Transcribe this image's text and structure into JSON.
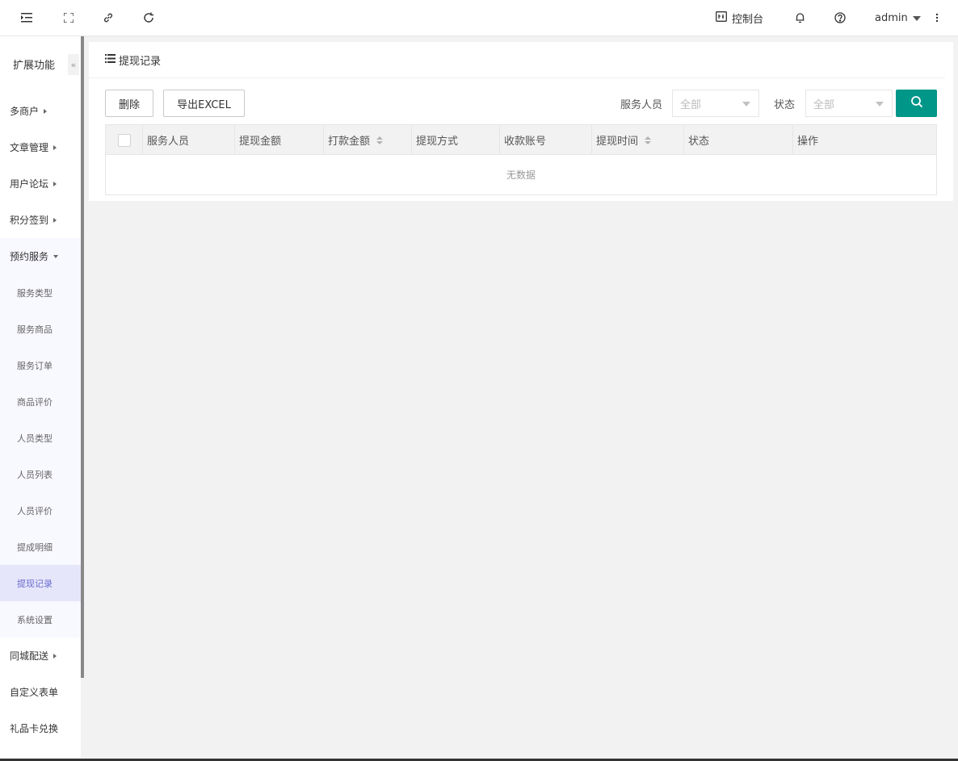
{
  "header": {
    "console_label": "控制台",
    "user_name": "admin",
    "icons": [
      "menu-fold-icon",
      "fullscreen-icon",
      "link-icon",
      "refresh-icon",
      "console-icon",
      "bell-icon",
      "help-icon",
      "more-vertical-icon"
    ]
  },
  "sidebar": {
    "title": "扩展功能",
    "collapse_label": "«",
    "items": [
      {
        "label": "多商户"
      },
      {
        "label": "文章管理"
      },
      {
        "label": "用户论坛"
      },
      {
        "label": "积分签到"
      },
      {
        "label": "预约服务"
      },
      {
        "label": "同城配送"
      },
      {
        "label": "自定义表单"
      },
      {
        "label": "礼品卡兑换"
      }
    ],
    "sub_items": [
      {
        "label": "服务类型"
      },
      {
        "label": "服务商品"
      },
      {
        "label": "服务订单"
      },
      {
        "label": "商品评价"
      },
      {
        "label": "人员类型"
      },
      {
        "label": "人员列表"
      },
      {
        "label": "人员评价"
      },
      {
        "label": "提成明细"
      },
      {
        "label": "提现记录"
      },
      {
        "label": "系统设置"
      }
    ]
  },
  "main": {
    "title": "提现记录",
    "buttons": {
      "delete": "删除",
      "export": "导出EXCEL"
    },
    "filters": {
      "staff_label": "服务人员",
      "staff_value": "全部",
      "status_label": "状态",
      "status_value": "全部"
    },
    "table": {
      "columns": [
        "服务人员",
        "提现金额",
        "打款金额",
        "提现方式",
        "收款账号",
        "提现时间",
        "状态",
        "操作"
      ],
      "empty_text": "无数据"
    }
  },
  "colors": {
    "primary": "#009688",
    "active_menu_bg": "#e6e6fa",
    "active_menu_text": "#6b6bcf"
  }
}
